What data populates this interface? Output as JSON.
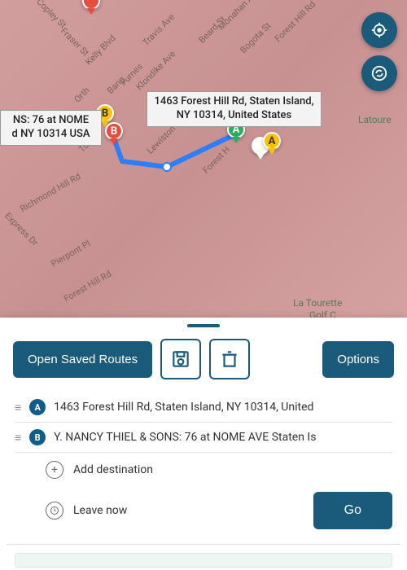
{
  "map": {
    "tooltip_main": "1463 Forest Hill Rd, Staten Island, NY 10314, United States",
    "tooltip_partial_line1": "NS: 76 at NOME",
    "tooltip_partial_line2": "d NY 10314 USA",
    "streets": {
      "copley": "Copley St",
      "fraser": "Fraser St",
      "kelly": "Kelly Blvd",
      "travis": "Travis Ave",
      "klondike": "Klondike Ave",
      "beard": "Beard St",
      "bogota": "Bogota St",
      "forest_hill": "Forest Hill Rd",
      "lewis": "Lewiston",
      "orth": "Orth",
      "bang": "Bang",
      "furness": "Furnes",
      "richmond": "Richmond Hill Rd",
      "express": "Express Dr",
      "pierpont": "Pierpont Pl",
      "forest_hill2": "Forest Hill Rd",
      "forest_h": "Forest H",
      "manahan": "Monahan Ave",
      "turin": "Turin"
    },
    "park_labels": {
      "latourette1": "Latoure",
      "latourette2_l1": "La Tourette",
      "latourette2_l2": "Golf C"
    },
    "markers": {
      "a_green": "A",
      "a_yellow": "A",
      "b_yellow": "B",
      "b_red": "B"
    }
  },
  "toolbar": {
    "open_saved": "Open Saved Routes",
    "save_icon": "save",
    "delete_icon": "delete",
    "options": "Options"
  },
  "stops": {
    "a_label": "A",
    "a_text": "1463 Forest Hill Rd, Staten Island, NY 10314, United",
    "b_label": "B",
    "b_text": "Y. NANCY THIEL & SONS: 76 at NOME AVE Staten Is"
  },
  "add_destination": "Add destination",
  "leave_now": "Leave now",
  "go": "Go",
  "colors": {
    "primary": "#1a5a7a"
  }
}
